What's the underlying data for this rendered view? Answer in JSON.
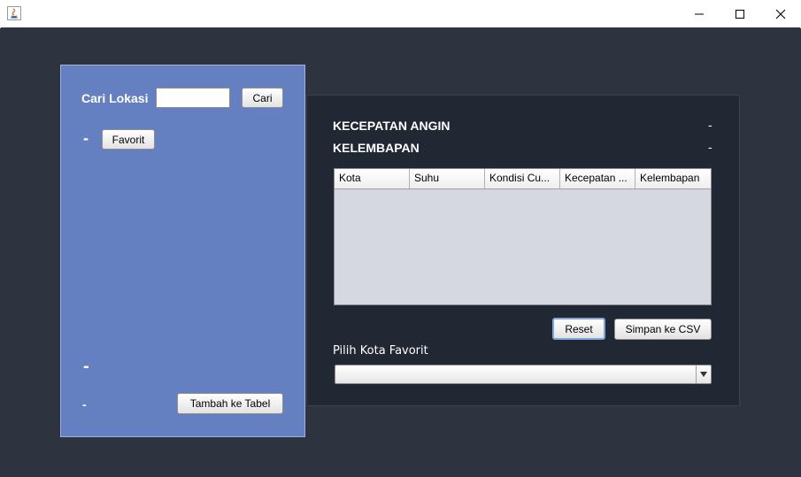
{
  "window": {
    "minimize_icon": "minimize-icon",
    "maximize_icon": "maximize-icon",
    "close_icon": "close-icon",
    "app_icon": "java-app-icon"
  },
  "left_panel": {
    "search_label": "Cari Lokasi",
    "search_value": "",
    "search_button": "Cari",
    "favorite_indicator": "-",
    "favorite_button": "Favorit",
    "bottom_value_1": "-",
    "bottom_value_2": "-",
    "add_to_table_button": "Tambah ke Tabel"
  },
  "right_panel": {
    "wind_speed_label": "KECEPATAN ANGIN",
    "wind_speed_value": "-",
    "humidity_label": "KELEMBAPAN",
    "humidity_value": "-",
    "table": {
      "columns": [
        "Kota",
        "Suhu",
        "Kondisi Cu...",
        "Kecepatan ...",
        "Kelembapan"
      ],
      "rows": []
    },
    "reset_button": "Reset",
    "save_csv_button": "Simpan ke CSV",
    "favorite_city_label": "Pilih Kota Favorit",
    "favorite_city_selected": ""
  },
  "colors": {
    "background": "#2e3340",
    "left_panel": "#6480c0",
    "right_panel": "#222833",
    "table_body": "#d5d8e0"
  }
}
